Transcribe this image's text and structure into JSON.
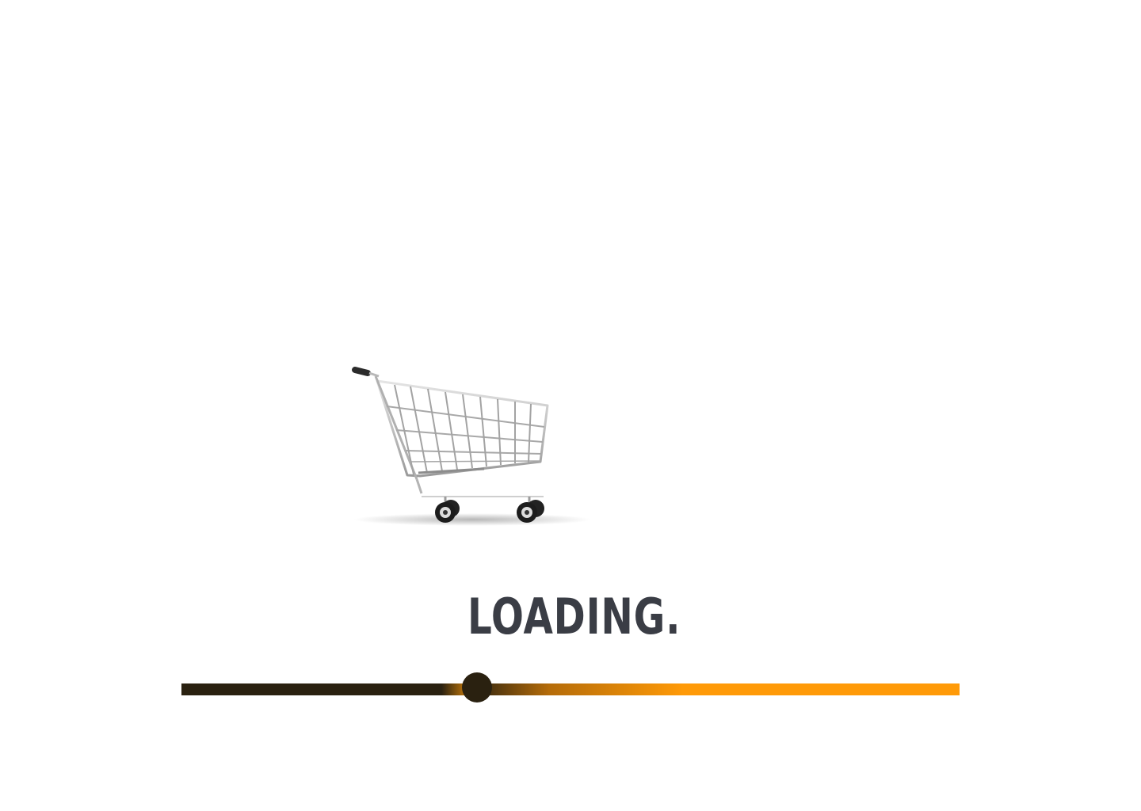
{
  "loader": {
    "status_text": "LOADING.",
    "progress": 0.38
  },
  "icons": {
    "cart": "shopping-cart-icon"
  },
  "colors": {
    "background": "#ffffff",
    "text": "#3a3d45",
    "progress_done": "#2a2110",
    "progress_remaining": "#ff9a08"
  }
}
